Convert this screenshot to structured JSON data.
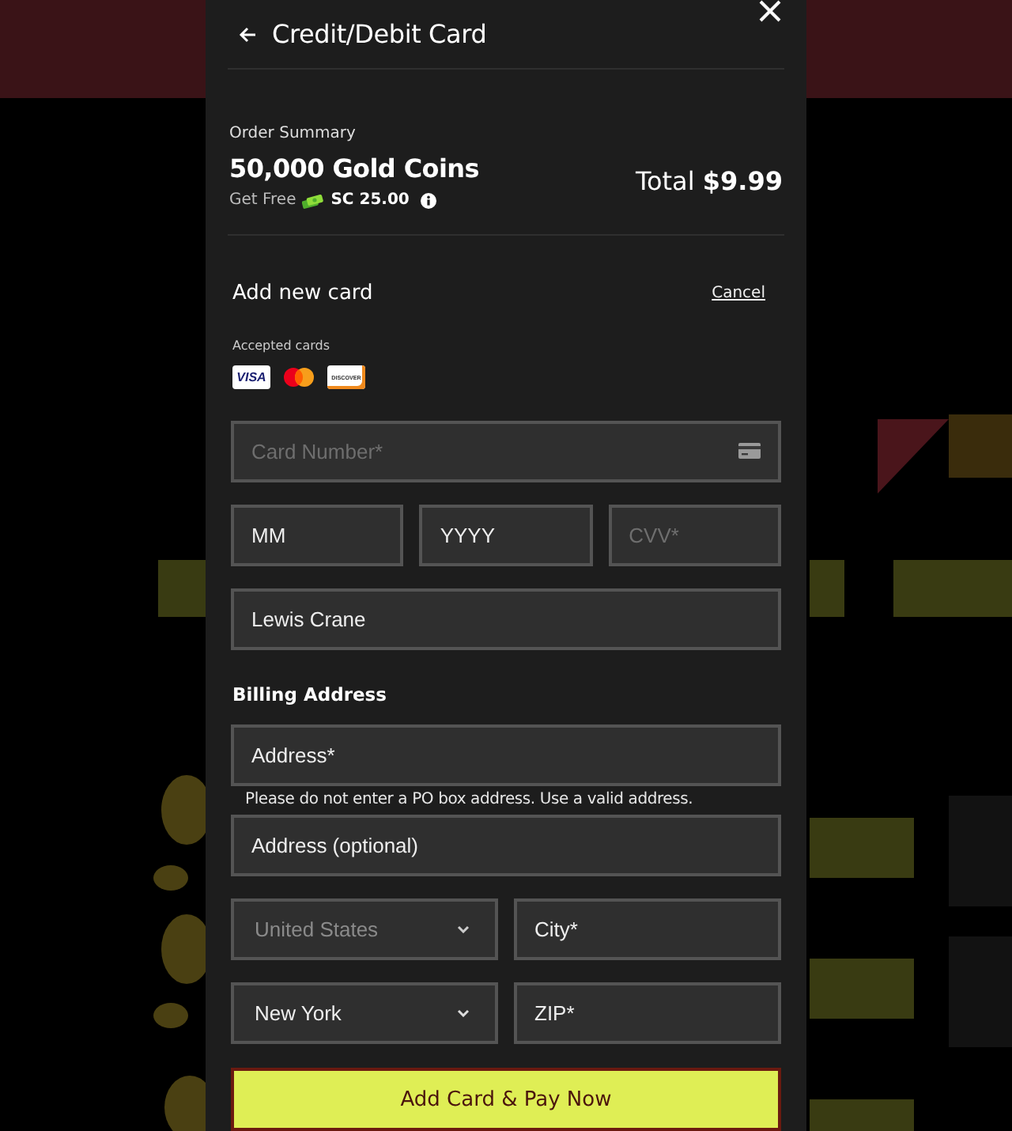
{
  "header": {
    "title": "Credit/Debit Card"
  },
  "order_summary": {
    "label": "Order Summary",
    "product": "50,000 Gold Coins",
    "bonus_prefix": "Get Free",
    "bonus_amount": "SC 25.00",
    "total_label": "Total",
    "total_amount": "$9.99"
  },
  "card_section": {
    "title": "Add new card",
    "cancel": "Cancel",
    "accepted_label": "Accepted cards",
    "accepted_cards": [
      {
        "kind": "visa",
        "text": "VISA"
      },
      {
        "kind": "mastercard"
      },
      {
        "kind": "discover",
        "text": "DISCOVER"
      }
    ]
  },
  "card_fields": [
    [
      {
        "kind": "card-input",
        "placeholder": "Card Number*"
      }
    ],
    [
      {
        "kind": "input",
        "label": "MM"
      },
      {
        "kind": "input",
        "label": "YYYY"
      },
      {
        "kind": "input",
        "placeholder": "CVV*"
      }
    ],
    [
      {
        "kind": "input",
        "value": "Lewis Crane"
      }
    ]
  ],
  "billing": {
    "title": "Billing Address",
    "fields": [
      [
        {
          "kind": "input",
          "label": "Address*",
          "helper": "Please do not enter a PO box address. Use a valid address."
        }
      ],
      [
        {
          "kind": "input",
          "label": "Address (optional)"
        }
      ],
      [
        {
          "kind": "select",
          "value": "United States",
          "disabled": true
        },
        {
          "kind": "input",
          "label": "City*"
        }
      ],
      [
        {
          "kind": "select",
          "value": "New York",
          "disabled": false
        },
        {
          "kind": "input",
          "label": "ZIP*"
        }
      ]
    ]
  },
  "submit": "Add Card & Pay Now"
}
